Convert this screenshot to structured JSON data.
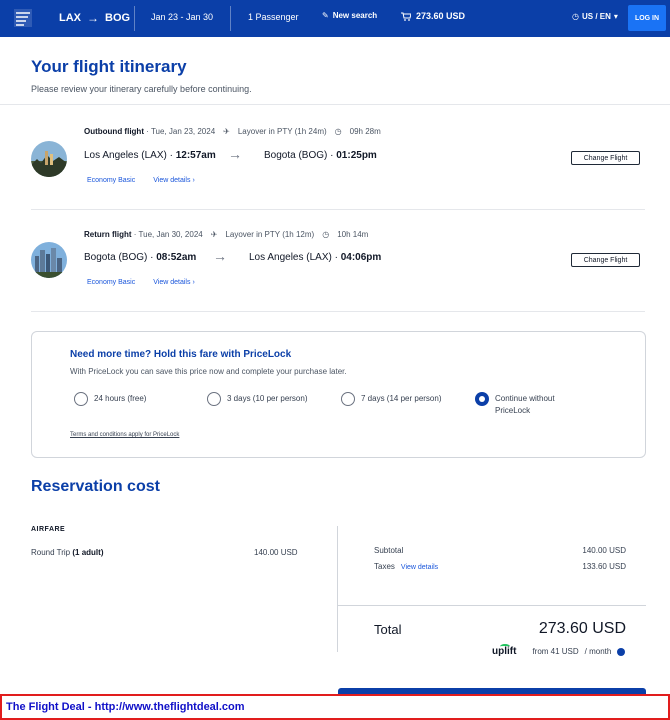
{
  "header": {
    "origin": "LAX",
    "destination": "BOG",
    "dates": "Jan 23 - Jan 30",
    "passengers": "1 Passenger",
    "new_search": "New search",
    "cart_total": "273.60 USD",
    "locale": "US / EN",
    "login": "LOG IN",
    "colors": {
      "bar": "#0b3fa8",
      "login": "#1a73f5"
    }
  },
  "page": {
    "title": "Your flight itinerary",
    "subtitle": "Please review your itinerary carefully before continuing."
  },
  "flights": [
    {
      "label": "Outbound flight",
      "date": "· Tue, Jan 23, 2024",
      "layover": "Layover in PTY (1h 24m)",
      "duration": "09h 28m",
      "from_city": "Los Angeles (LAX) · ",
      "from_time": "12:57am",
      "to_city": "Bogota (BOG) · ",
      "to_time": "01:25pm",
      "fare": "Economy Basic",
      "details": "View details",
      "change": "Change Flight"
    },
    {
      "label": "Return flight",
      "date": "· Tue, Jan 30, 2024",
      "layover": "Layover in PTY (1h 12m)",
      "duration": "10h 14m",
      "from_city": "Bogota (BOG) · ",
      "from_time": "08:52am",
      "to_city": "Los Angeles (LAX) · ",
      "to_time": "04:06pm",
      "fare": "Economy Basic",
      "details": "View details",
      "change": "Change Flight"
    }
  ],
  "pricelock": {
    "title": "Need more time? Hold this fare with PriceLock",
    "description": "With PriceLock you can save this price now and complete your purchase later.",
    "options": [
      {
        "label": "24 hours (free)",
        "selected": false
      },
      {
        "label": "3 days (10 per person)",
        "selected": false
      },
      {
        "label": "7 days (14 per person)",
        "selected": false
      },
      {
        "label": "Continue without PriceLock",
        "selected": true
      }
    ],
    "terms": "Terms and conditions apply for PriceLock"
  },
  "reservation": {
    "title": "Reservation cost",
    "airfare_heading": "AIRFARE",
    "round_trip": "Round Trip",
    "adults": "(1 adult)",
    "round_trip_amount": "140.00 USD",
    "subtotal_label": "Subtotal",
    "subtotal": "140.00 USD",
    "taxes_label": "Taxes",
    "taxes_link": "View details",
    "taxes": "133.60 USD",
    "total_label": "Total",
    "total": "273.60 USD",
    "uplift_logo": "uplift",
    "uplift_price": "from 41 USD",
    "uplift_period": "/ month"
  },
  "watermark": "The Flight Deal - http://www.theflightdeal.com"
}
